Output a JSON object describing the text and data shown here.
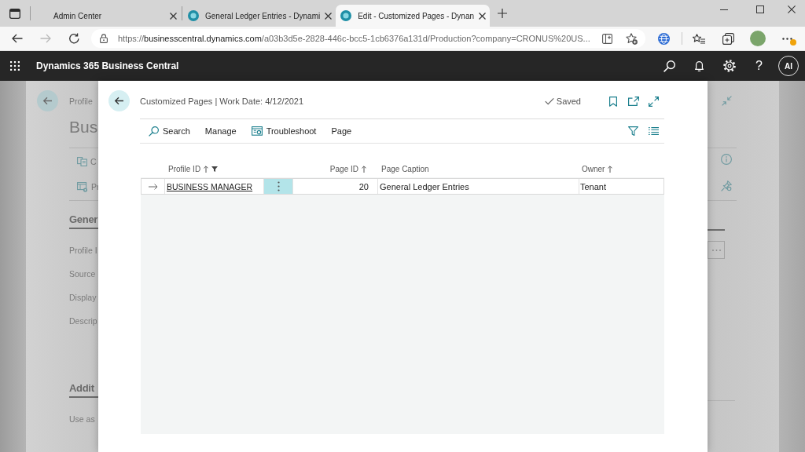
{
  "browser": {
    "tabs": [
      {
        "title": "Admin Center",
        "kind": "plain",
        "selected": false
      },
      {
        "title": "General Ledger Entries - Dynami",
        "kind": "app",
        "selected": false
      },
      {
        "title": "Edit - Customized Pages - Dynan",
        "kind": "app",
        "selected": true
      }
    ],
    "nav": [
      {
        "kind": "back",
        "disabled": false
      },
      {
        "kind": "forward",
        "disabled": true
      },
      {
        "kind": "refresh",
        "disabled": false
      }
    ],
    "url": {
      "scheme": "https://",
      "host": "businesscentral.dynamics.com",
      "path": "/a03b3d5e-2828-446c-bcc5-1cb6376a131d/Production?company=CRONUS%20US..."
    }
  },
  "app_bar": {
    "title": "Dynamics 365 Business Central",
    "help": "?",
    "avatar": "AI"
  },
  "background_page": {
    "breadcrumb": "Profile",
    "title": "Bus",
    "actions": [
      {
        "label": "C",
        "kind": "copy"
      },
      {
        "label": "Pr",
        "kind": "settings"
      }
    ],
    "sections": [
      {
        "heading": "Gener",
        "fields": [
          "Profile I",
          "Source",
          "Display",
          "Descrip"
        ]
      },
      {
        "heading": "Addit",
        "fields": [
          "Use as"
        ]
      }
    ]
  },
  "dialog": {
    "caption": "Customized Pages | Work Date: 4/12/2021",
    "status": "Saved",
    "actions": [
      {
        "label": "Search",
        "kind": "search"
      },
      {
        "label": "Manage",
        "kind": "menu"
      },
      {
        "label": "Troubleshoot",
        "kind": "troubleshoot"
      },
      {
        "label": "Page",
        "kind": "menu"
      }
    ],
    "table": {
      "columns": [
        {
          "label": "Profile ID",
          "sorted": true,
          "filtered": true
        },
        {
          "label": "Page ID",
          "sorted": true,
          "filtered": false
        },
        {
          "label": "Page Caption",
          "sorted": false,
          "filtered": false
        },
        {
          "label": "Owner",
          "sorted": true,
          "filtered": false
        }
      ],
      "rows": [
        {
          "selected": true,
          "profile_id": "BUSINESS MANAGER",
          "page_id": "20",
          "page_caption": "General Ledger Entries",
          "owner": "Tenant"
        }
      ]
    }
  }
}
